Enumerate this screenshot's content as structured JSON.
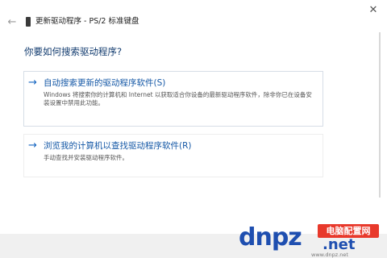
{
  "window": {
    "title": "更新驱动程序 - PS/2 标准键盘",
    "back_icon": "back-arrow-icon",
    "close_label": "✕"
  },
  "main": {
    "heading": "你要如何搜索驱动程序?",
    "options": [
      {
        "title": "自动搜索更新的驱动程序软件(S)",
        "description": "Windows 将搜索你的计算机和 Internet 以获取适合你设备的最新驱动程序软件，除非你已在设备安装设置中禁用此功能。"
      },
      {
        "title": "浏览我的计算机以查找驱动程序软件(R)",
        "description": "手动查找并安装驱动程序软件。"
      }
    ]
  },
  "watermark": {
    "logo": "dnpz",
    "badge": "电脑配置网",
    "suffix": ".net",
    "domain": "www.dnpz.net"
  },
  "colors": {
    "accent": "#1565c0",
    "heading": "#103a6e",
    "footer": "#f0f0f0",
    "badge": "#e8392b"
  }
}
